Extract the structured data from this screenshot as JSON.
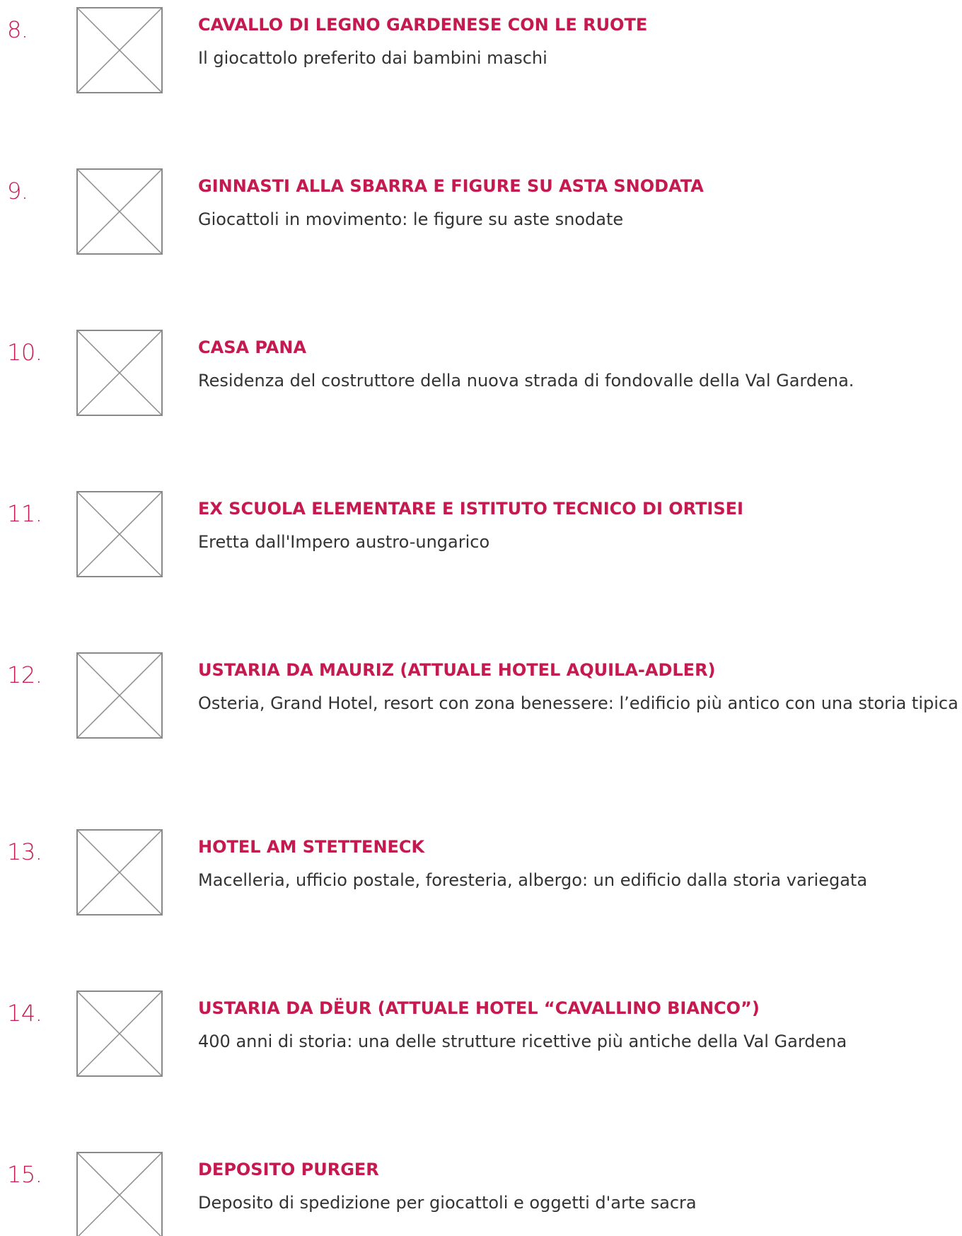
{
  "colors": {
    "accent": "#c41a4f",
    "text": "#333333",
    "placeholder_border": "#8a8a8a"
  },
  "items": [
    {
      "number": "8.",
      "title": "CAVALLO DI LEGNO GARDENESE CON LE RUOTE",
      "description": "Il giocattolo preferito dai bambini maschi",
      "image_icon": "broken-image-placeholder-icon"
    },
    {
      "number": "9.",
      "title": "GINNASTI ALLA SBARRA E FIGURE SU ASTA SNODATA",
      "description": "Giocattoli in movimento: le figure su aste snodate",
      "image_icon": "broken-image-placeholder-icon"
    },
    {
      "number": "10.",
      "title": "CASA PANA",
      "description": "Residenza del costruttore della nuova strada di fondovalle della Val Gardena.",
      "image_icon": "broken-image-placeholder-icon"
    },
    {
      "number": "11.",
      "title": "EX SCUOLA ELEMENTARE E ISTITUTO TECNICO DI ORTISEI",
      "description": "Eretta dall'Impero austro-ungarico",
      "image_icon": "broken-image-placeholder-icon"
    },
    {
      "number": "12.",
      "title": "USTARIA DA MAURIZ (ATTUALE HOTEL AQUILA-ADLER)",
      "description": "Osteria, Grand Hotel, resort con zona benessere: l’edificio più antico con una storia tipica",
      "image_icon": "broken-image-placeholder-icon"
    },
    {
      "number": "13.",
      "title": "HOTEL AM STETTENECK",
      "description": "Macelleria, ufficio postale, foresteria, albergo: un edificio dalla storia variegata",
      "image_icon": "broken-image-placeholder-icon"
    },
    {
      "number": "14.",
      "title": "USTARIA DA DËUR (ATTUALE HOTEL “CAVALLINO BIANCO”)",
      "description": "400 anni di storia: una delle strutture ricettive più antiche della Val Gardena",
      "image_icon": "broken-image-placeholder-icon"
    },
    {
      "number": "15.",
      "title": "DEPOSITO PURGER",
      "description": "Deposito di spedizione per giocattoli e oggetti d'arte sacra",
      "image_icon": "broken-image-placeholder-icon"
    }
  ]
}
